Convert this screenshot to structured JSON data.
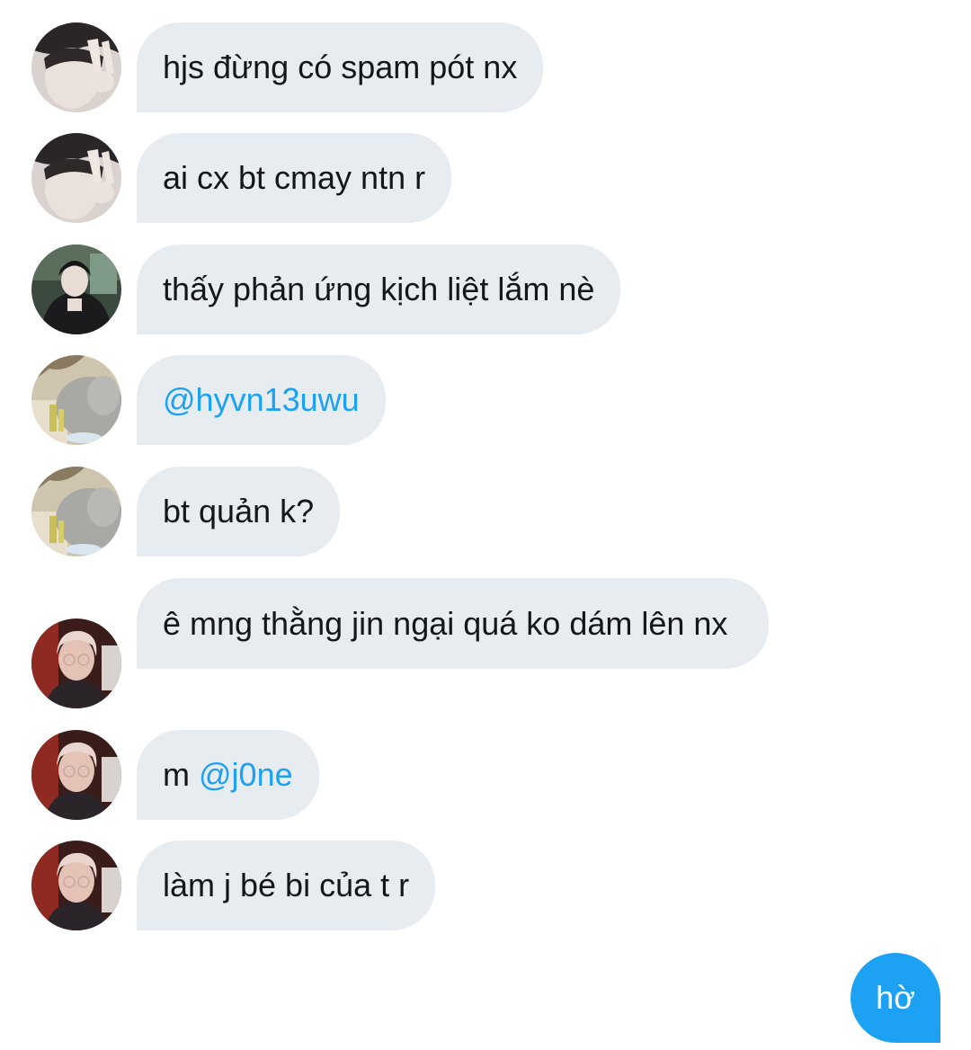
{
  "messages": [
    {
      "sender": "user-a",
      "avatar": "avatar-peace-sign",
      "text": "hjs đừng có spam pót nx"
    },
    {
      "sender": "user-a",
      "avatar": "avatar-peace-sign",
      "text": "ai cx bt cmay ntn r"
    },
    {
      "sender": "user-b",
      "avatar": "avatar-dark-jacket",
      "text": "thấy phản ứng kịch liệt lắm nè"
    },
    {
      "sender": "user-c",
      "avatar": "avatar-plush-toy",
      "mention": "@hyvn13uwu"
    },
    {
      "sender": "user-c",
      "avatar": "avatar-plush-toy",
      "text": "bt quản k?"
    },
    {
      "sender": "user-d",
      "avatar": "avatar-glasses-red-light",
      "text": "ê mng thằng jin ngại quá ko dám lên nx"
    },
    {
      "sender": "user-d",
      "avatar": "avatar-glasses-red-light",
      "prefix": "m ",
      "mention": "@j0ne"
    },
    {
      "sender": "user-d",
      "avatar": "avatar-glasses-red-light",
      "text": "làm j bé bi của t r"
    }
  ],
  "outgoing": [
    {
      "text": "hờ"
    }
  ],
  "colors": {
    "incoming_bubble": "#e6ecf0",
    "outgoing_bubble": "#1da1f2",
    "mention": "#1da1f2",
    "text": "#14171a"
  }
}
